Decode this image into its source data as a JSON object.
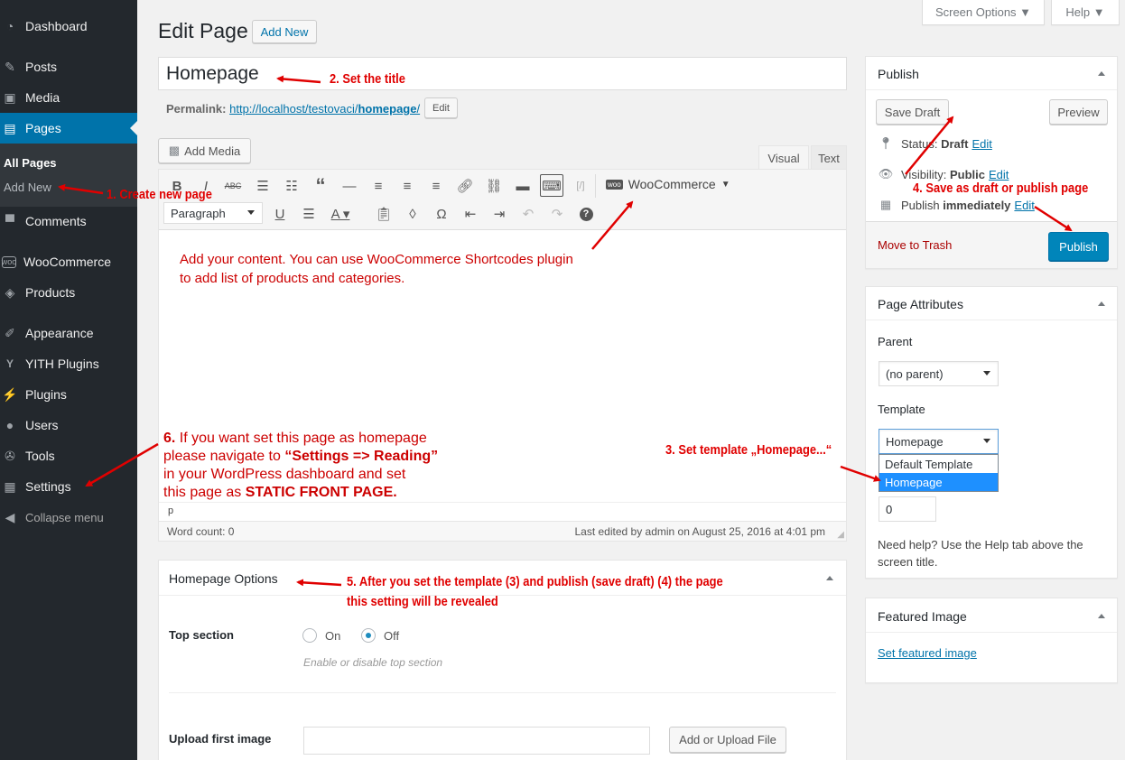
{
  "top_bar": {
    "screen_options": "Screen Options ▼",
    "help": "Help ▼"
  },
  "sidebar": {
    "items": [
      {
        "label": "Dashboard",
        "icon": "dashboard-icon"
      },
      {
        "label": "Posts",
        "icon": "pin-icon"
      },
      {
        "label": "Media",
        "icon": "media-icon"
      },
      {
        "label": "Pages",
        "icon": "pages-icon"
      },
      {
        "label": "Comments",
        "icon": "comment-icon"
      },
      {
        "label": "WooCommerce",
        "icon": "woo-icon"
      },
      {
        "label": "Products",
        "icon": "box-icon"
      },
      {
        "label": "Appearance",
        "icon": "brush-icon"
      },
      {
        "label": "YITH Plugins",
        "icon": "yith-icon"
      },
      {
        "label": "Plugins",
        "icon": "plug-icon"
      },
      {
        "label": "Users",
        "icon": "user-icon"
      },
      {
        "label": "Tools",
        "icon": "wrench-icon"
      },
      {
        "label": "Settings",
        "icon": "settings-icon"
      }
    ],
    "submenu": [
      "All Pages",
      "Add New"
    ],
    "collapse": "Collapse menu"
  },
  "header": {
    "title": "Edit Page",
    "add_new": "Add New"
  },
  "title_field": {
    "value": "Homepage"
  },
  "permalink": {
    "label": "Permalink:",
    "url_base": "http://localhost/testovaci/",
    "slug": "homepage",
    "url_tail": "/",
    "edit": "Edit"
  },
  "editor": {
    "add_media": "Add Media",
    "tab_visual": "Visual",
    "tab_text": "Text",
    "woocommerce": "WooCommerce",
    "format_select": "Paragraph",
    "content_lines": [
      "Add your content. You can use WooCommerce Shortcodes plugin",
      "to add list of products and categories."
    ],
    "path": "p",
    "word_count": "Word count: 0",
    "last_edited": "Last edited by admin on August 25, 2016 at 4:01 pm"
  },
  "publish": {
    "title": "Publish",
    "save_draft": "Save Draft",
    "preview": "Preview",
    "status_label": "Status:",
    "status_value": "Draft",
    "visibility_label": "Visibility:",
    "visibility_value": "Public",
    "publish_label": "Publish",
    "publish_value": "immediately",
    "edit": "Edit",
    "trash": "Move to Trash",
    "publish_button": "Publish"
  },
  "page_attributes": {
    "title": "Page Attributes",
    "parent_label": "Parent",
    "parent_value": "(no parent)",
    "template_label": "Template",
    "template_value": "Homepage",
    "template_options": [
      "Default Template",
      "Homepage"
    ],
    "order_value": "0",
    "help_lines": [
      "Need help? Use the Help tab above the",
      "screen title."
    ]
  },
  "featured_image": {
    "title": "Featured Image",
    "link": "Set featured image"
  },
  "homepage_options": {
    "title": "Homepage Options",
    "top_section_label": "Top section",
    "on": "On",
    "off": "Off",
    "top_section_value": "Off",
    "hint": "Enable or disable top section",
    "upload_label": "Upload first image",
    "upload_button": "Add or Upload File"
  },
  "annotations": {
    "a1": "1. Create new page",
    "a2": "2. Set the title",
    "a3": "3. Set template „Homepage...“",
    "a4": "4. Save as draft or publish page",
    "a5_line1": "5. After you set the template (3) and publish (save draft) (4) the page",
    "a5_line2": "this setting will be revealed",
    "a6_num": "6.",
    "a6_l1": " If you want set this page as homepage",
    "a6_l2a": "please navigate to ",
    "a6_l2b": "“Settings => Reading”",
    "a6_l3": "in your WordPress dashboard and set",
    "a6_l4a": "this page as ",
    "a6_l4b": "STATIC FRONT PAGE."
  },
  "colors": {
    "sidebar": "#23282d",
    "accent": "#0073aa",
    "annotation": "#e00000",
    "publish_button": "#0085ba"
  }
}
